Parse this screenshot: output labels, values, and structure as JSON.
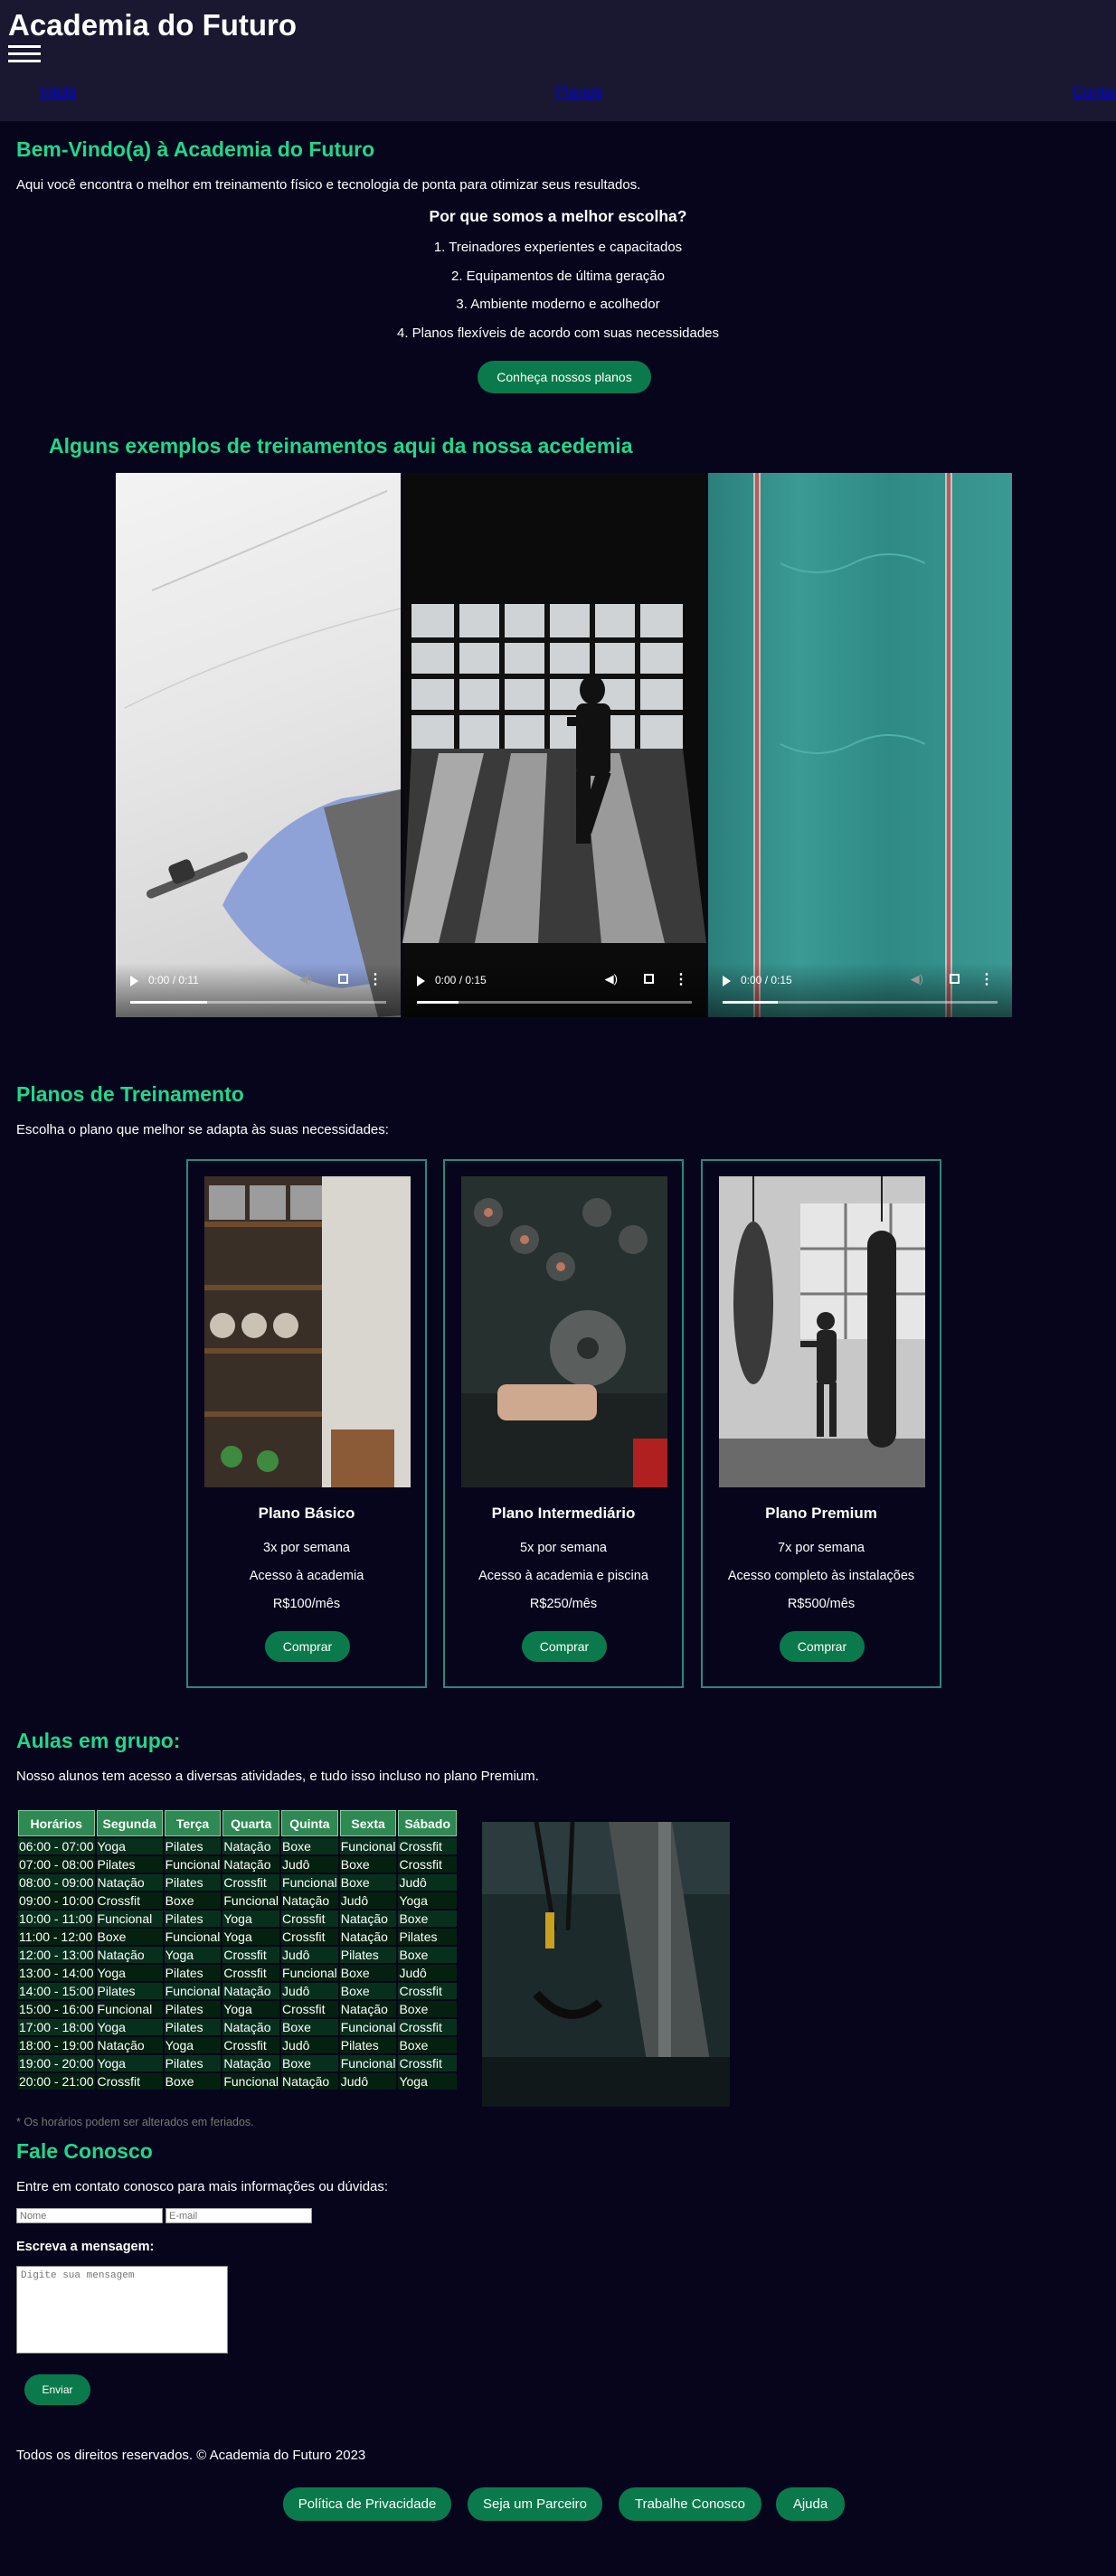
{
  "header": {
    "title": "Academia do Futuro",
    "menu_icon": "hamburger-menu-icon",
    "nav": [
      "Início",
      "Planos",
      "Contato"
    ]
  },
  "welcome": {
    "title": "Bem-Vindo(a) à Academia do Futuro",
    "intro": "Aqui você encontra o melhor em treinamento físico e tecnologia de ponta para otimizar seus resultados.",
    "why_title": "Por que somos a melhor escolha?",
    "reasons": [
      "1. Treinadores experientes e capacitados",
      "2. Equipamentos de última geração",
      "3. Ambiente moderno e acolhedor",
      "4. Planos flexíveis de acordo com suas necessidades"
    ],
    "cta": "Conheça nossos planos"
  },
  "videos": {
    "title": "Alguns exemplos de treinamentos aqui da nossa acedemia",
    "items": [
      {
        "time": "0:00 / 0:11",
        "progress": 0.3
      },
      {
        "time": "0:00 / 0:15",
        "progress": 0.15
      },
      {
        "time": "0:00 / 0:15",
        "progress": 0.2
      }
    ]
  },
  "plans": {
    "title": "Planos de Treinamento",
    "subtitle": "Escolha o plano que melhor se adapta às suas necessidades:",
    "items": [
      {
        "name": "Plano Básico",
        "freq": "3x por semana",
        "access": "Acesso à academia",
        "price": "R$100/mês",
        "button": "Comprar"
      },
      {
        "name": "Plano Intermediário",
        "freq": "5x por semana",
        "access": "Acesso à academia e piscina",
        "price": "R$250/mês",
        "button": "Comprar"
      },
      {
        "name": "Plano Premium",
        "freq": "7x por semana",
        "access": "Acesso completo às instalações",
        "price": "R$500/mês",
        "button": "Comprar"
      }
    ]
  },
  "classes": {
    "title": "Aulas em grupo:",
    "subtitle": "Nosso alunos tem acesso a diversas atividades, e tudo isso incluso no plano Premium.",
    "headers": [
      "Horários",
      "Segunda",
      "Terça",
      "Quarta",
      "Quinta",
      "Sexta",
      "Sábado"
    ],
    "rows": [
      [
        "06:00 - 07:00",
        "Yoga",
        "Pilates",
        "Natação",
        "Boxe",
        "Funcional",
        "Crossfit"
      ],
      [
        "07:00 - 08:00",
        "Pilates",
        "Funcional",
        "Natação",
        "Judô",
        "Boxe",
        "Crossfit"
      ],
      [
        "08:00 - 09:00",
        "Natação",
        "Pilates",
        "Crossfit",
        "Funcional",
        "Boxe",
        "Judô"
      ],
      [
        "09:00 - 10:00",
        "Crossfit",
        "Boxe",
        "Funcional",
        "Natação",
        "Judô",
        "Yoga"
      ],
      [
        "10:00 - 11:00",
        "Funcional",
        "Pilates",
        "Yoga",
        "Crossfit",
        "Natação",
        "Boxe"
      ],
      [
        "11:00 - 12:00",
        "Boxe",
        "Funcional",
        "Yoga",
        "Crossfit",
        "Natação",
        "Pilates"
      ],
      [
        "12:00 - 13:00",
        "Natação",
        "Yoga",
        "Crossfit",
        "Judô",
        "Pilates",
        "Boxe"
      ],
      [
        "13:00 - 14:00",
        "Yoga",
        "Pilates",
        "Crossfit",
        "Funcional",
        "Boxe",
        "Judô"
      ],
      [
        "14:00 - 15:00",
        "Pilates",
        "Funcional",
        "Natação",
        "Judô",
        "Boxe",
        "Crossfit"
      ],
      [
        "15:00 - 16:00",
        "Funcional",
        "Pilates",
        "Yoga",
        "Crossfit",
        "Natação",
        "Boxe"
      ],
      [
        "17:00 - 18:00",
        "Yoga",
        "Pilates",
        "Natação",
        "Boxe",
        "Funcional",
        "Crossfit"
      ],
      [
        "18:00 - 19:00",
        "Natação",
        "Yoga",
        "Crossfit",
        "Judô",
        "Pilates",
        "Boxe"
      ],
      [
        "19:00 - 20:00",
        "Yoga",
        "Pilates",
        "Natação",
        "Boxe",
        "Funcional",
        "Crossfit"
      ],
      [
        "20:00 - 21:00",
        "Crossfit",
        "Boxe",
        "Funcional",
        "Natação",
        "Judô",
        "Yoga"
      ]
    ],
    "note": "* Os horários podem ser alterados em feriados."
  },
  "contact": {
    "title": "Fale Conosco",
    "subtitle": "Entre em contato conosco para mais informações ou dúvidas:",
    "name_placeholder": "Nome",
    "email_placeholder": "E-mail",
    "message_label": "Escreva a mensagem:",
    "message_placeholder": "Digite sua mensagem",
    "send": "Enviar"
  },
  "footer": {
    "copyright": "Todos os direitos reservados. © Academia do Futuro 2023",
    "links": [
      "Política de Privacidade",
      "Seja um Parceiro",
      "Trabalhe Conosco",
      "Ajuda"
    ]
  },
  "colors": {
    "background": "#06051c",
    "header": "#191830",
    "accent": "#1fd88c",
    "button": "#0a7a4c"
  }
}
